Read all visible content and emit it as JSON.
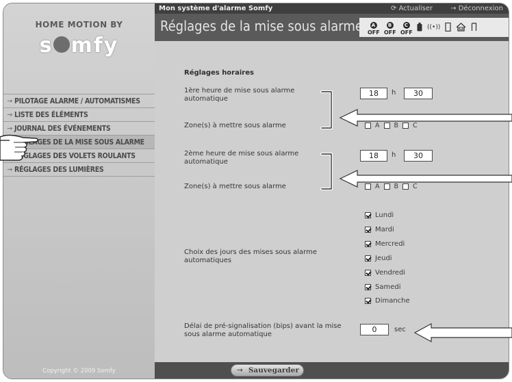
{
  "topbar": {
    "system_title": "Mon système d'alarme Somfy",
    "refresh_label": "Actualiser",
    "logout_label": "Déconnexion"
  },
  "brand": {
    "top_line": "HOME MOTION BY",
    "logo_text": "somfy"
  },
  "header": {
    "title": "Réglages de la mise sous alarme",
    "zones": [
      {
        "letter": "A",
        "state": "OFF"
      },
      {
        "letter": "B",
        "state": "OFF"
      },
      {
        "letter": "C",
        "state": "OFF"
      }
    ],
    "status_icons": [
      "battery-icon",
      "radio-signal-icon",
      "door-icon",
      "home-icon",
      "window-icon"
    ]
  },
  "sidebar": {
    "items": [
      {
        "label": "PILOTAGE ALARME / AUTOMATISMES",
        "active": false
      },
      {
        "label": "LISTE DES ÉLÉMENTS",
        "active": false
      },
      {
        "label": "JOURNAL DES ÉVÉNEMENTS",
        "active": false
      },
      {
        "label": "RÉGLAGES DE LA MISE SOUS ALARME",
        "active": true
      },
      {
        "label": "RÉGLAGES DES VOLETS ROULANTS",
        "active": false
      },
      {
        "label": "RÉGLAGES DES LUMIÈRES",
        "active": false
      }
    ],
    "copyright": "Copyright © 2009 Somfy"
  },
  "form": {
    "section_title": "Réglages horaires",
    "first": {
      "label": "1ère heure de mise sous alarme automatique",
      "hour": "18",
      "hour_unit": "h",
      "minute": "30",
      "zones_label": "Zone(s) à mettre sous alarme",
      "zones": [
        {
          "label": "A",
          "checked": false
        },
        {
          "label": "B",
          "checked": false
        },
        {
          "label": "C",
          "checked": false
        }
      ]
    },
    "second": {
      "label": "2ème heure de mise sous alarme automatique",
      "hour": "18",
      "hour_unit": "h",
      "minute": "30",
      "zones_label": "Zone(s) à mettre sous alarme",
      "zones": [
        {
          "label": "A",
          "checked": false
        },
        {
          "label": "B",
          "checked": false
        },
        {
          "label": "C",
          "checked": false
        }
      ]
    },
    "days_label": "Choix des jours des mises sous alarme automatiques",
    "days": [
      {
        "label": "Lundi",
        "checked": true
      },
      {
        "label": "Mardi",
        "checked": true
      },
      {
        "label": "Mercredi",
        "checked": true
      },
      {
        "label": "Jeudi",
        "checked": true
      },
      {
        "label": "Vendredi",
        "checked": true
      },
      {
        "label": "Samedi",
        "checked": true
      },
      {
        "label": "Dimanche",
        "checked": true
      }
    ],
    "delay_label": "Délai de pré-signalisation (bips) avant la mise sous alarme automatique",
    "delay_value": "0",
    "delay_unit": "sec",
    "save_label": "Sauvegarder"
  }
}
